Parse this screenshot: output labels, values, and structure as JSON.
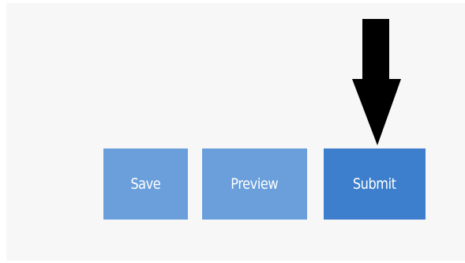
{
  "buttons": {
    "save_label": "Save",
    "preview_label": "Preview",
    "submit_label": "Submit"
  },
  "colors": {
    "save": "#6a9fdb",
    "preview": "#6a9fdb",
    "submit": "#3d7fcc",
    "panel_background": "#f7f7f7",
    "arrow": "#000000"
  },
  "annotation": {
    "icon": "down-arrow-icon",
    "points_to": "Submit"
  }
}
